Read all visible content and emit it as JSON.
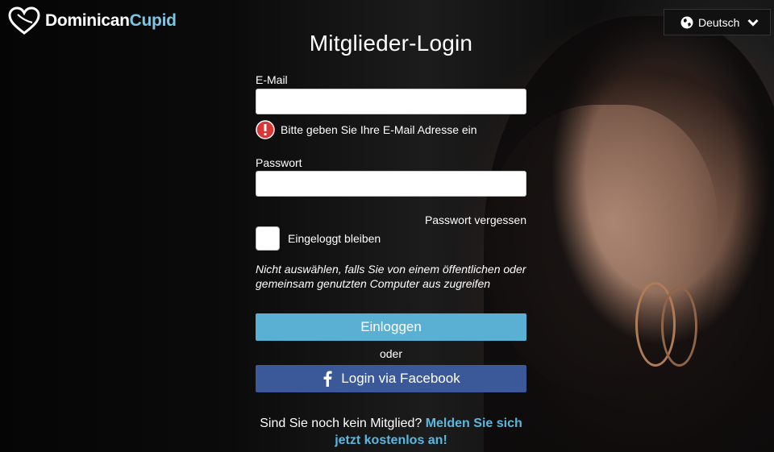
{
  "brand": {
    "name_part1": "Dominican",
    "name_part2": "Cupid",
    "logo_icon": "heart-logo-icon",
    "accent_color": "#7cc6e4"
  },
  "language": {
    "selected": "Deutsch",
    "icon": "globe-icon"
  },
  "login": {
    "title": "Mitglieder-Login",
    "email_label": "E-Mail",
    "email_value": "",
    "email_error": "Bitte geben Sie Ihre E-Mail Adresse ein",
    "password_label": "Passwort",
    "password_value": "",
    "forgot_password": "Passwort vergessen",
    "remember_label": "Eingeloggt bleiben",
    "remember_checked": false,
    "remember_note": "Nicht auswählen, falls Sie von einem öffentlichen oder gemeinsam genutzten Computer aus zugreifen",
    "login_button": "Einloggen",
    "or_text": "oder",
    "facebook_button": "Login via Facebook",
    "login_button_color": "#5ab0d2",
    "facebook_button_color": "#3b5998"
  },
  "signup": {
    "prompt": "Sind Sie noch kein Mitglied? ",
    "link": "Melden Sie sich jetzt kostenlos an!"
  }
}
